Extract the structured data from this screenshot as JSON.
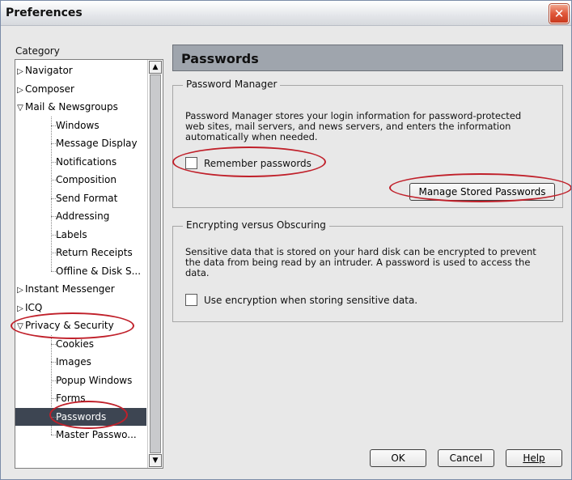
{
  "window": {
    "title": "Preferences",
    "close_glyph": "✕"
  },
  "sidebar": {
    "label": "Category",
    "items": [
      {
        "label": "Navigator",
        "arrow": "▷"
      },
      {
        "label": "Composer",
        "arrow": "▷"
      },
      {
        "label": "Mail & Newsgroups",
        "arrow": "▽"
      },
      {
        "label": "Windows"
      },
      {
        "label": "Message Display"
      },
      {
        "label": "Notifications"
      },
      {
        "label": "Composition"
      },
      {
        "label": "Send Format"
      },
      {
        "label": "Addressing"
      },
      {
        "label": "Labels"
      },
      {
        "label": "Return Receipts"
      },
      {
        "label": "Offline & Disk S..."
      },
      {
        "label": "Instant Messenger",
        "arrow": "▷"
      },
      {
        "label": "ICQ",
        "arrow": "▷"
      },
      {
        "label": "Privacy & Security",
        "arrow": "▽"
      },
      {
        "label": "Cookies"
      },
      {
        "label": "Images"
      },
      {
        "label": "Popup Windows"
      },
      {
        "label": "Forms"
      },
      {
        "label": "Passwords"
      },
      {
        "label": "Master Passwo..."
      }
    ],
    "selected": "Passwords"
  },
  "panel": {
    "title": "Passwords",
    "password_manager": {
      "legend": "Password Manager",
      "desc_lines": [
        "Password Manager stores your login information for password-protected",
        "web sites, mail servers, and news servers, and enters the information",
        "automatically when needed."
      ],
      "remember_label": "Remember passwords",
      "manage_button": "Manage Stored Passwords"
    },
    "encrypting": {
      "legend": "Encrypting versus Obscuring",
      "desc_lines": [
        "Sensitive data that is stored on your hard disk can be encrypted to prevent",
        "the data from being read by an intruder. A password is used to access the",
        "data."
      ],
      "encryption_label": "Use encryption when storing sensitive data."
    }
  },
  "footer": {
    "ok": "OK",
    "cancel": "Cancel",
    "help": "Help"
  },
  "colors": {
    "annotation": "#c0202a",
    "selection": "#3d4552"
  }
}
